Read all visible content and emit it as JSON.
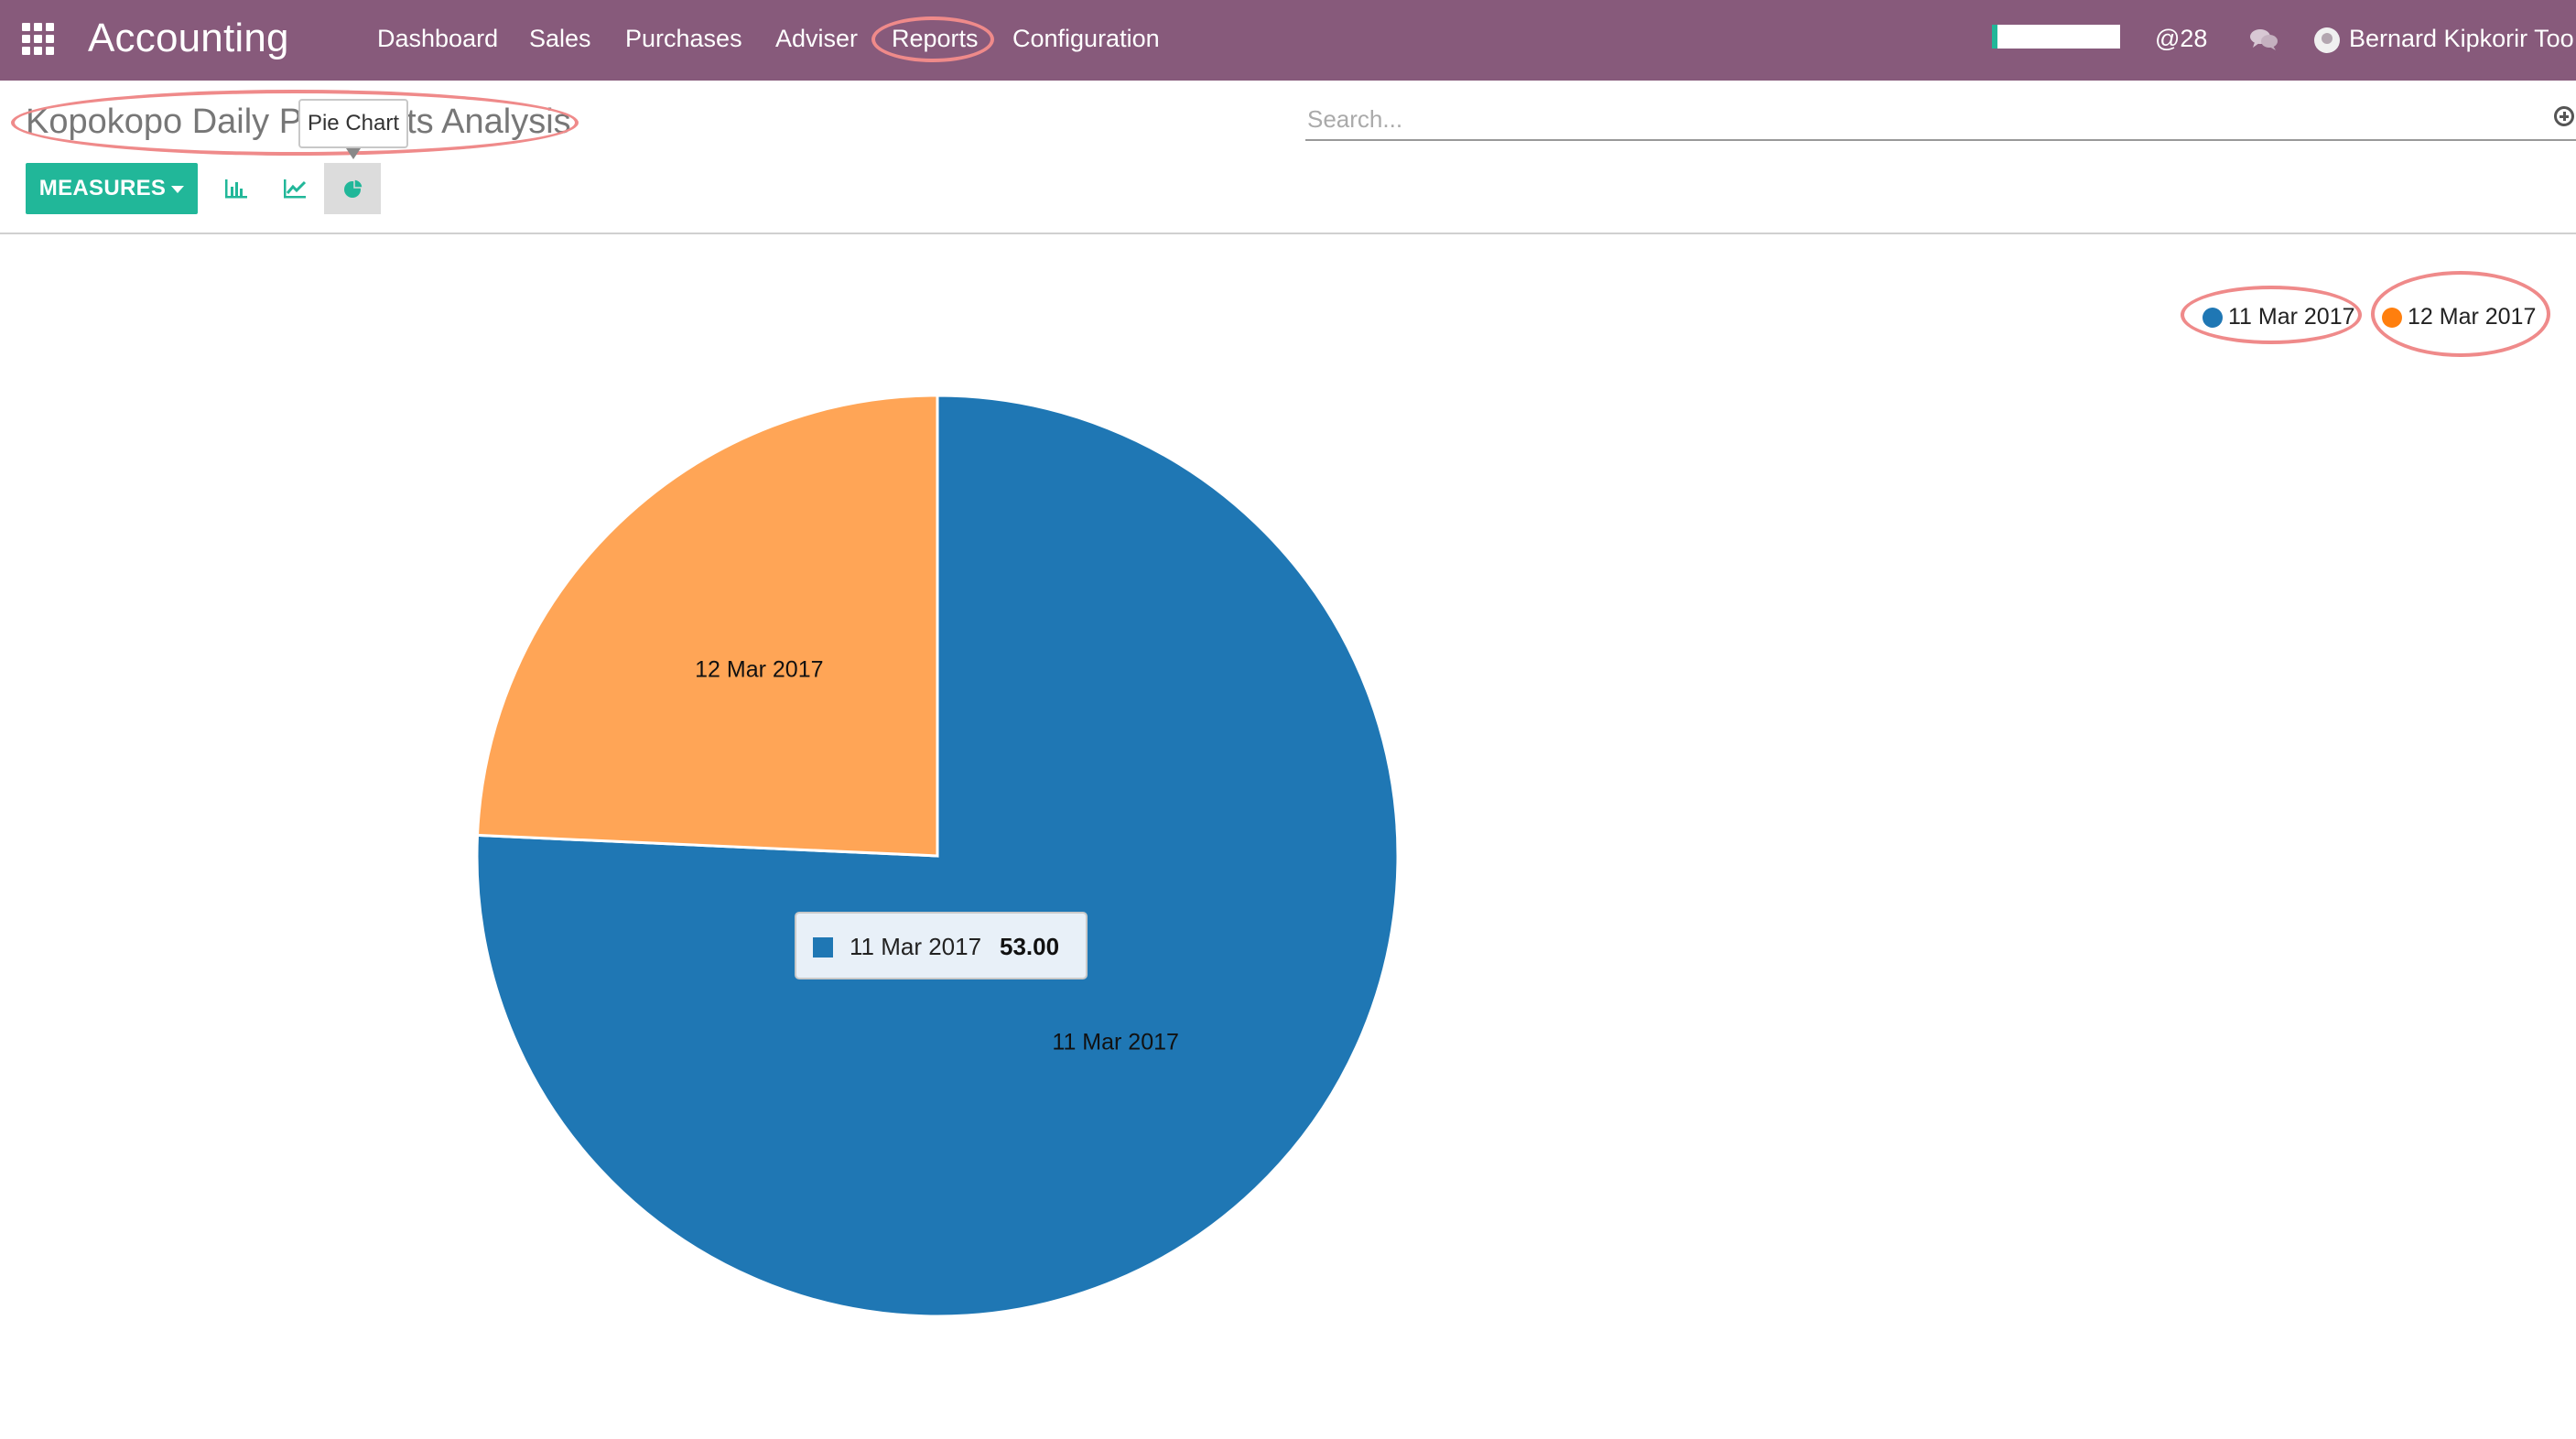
{
  "navbar": {
    "brand": "Accounting",
    "menu": [
      {
        "label": "Dashboard"
      },
      {
        "label": "Sales"
      },
      {
        "label": "Purchases"
      },
      {
        "label": "Adviser"
      },
      {
        "label": "Reports"
      },
      {
        "label": "Configuration"
      }
    ],
    "mentions_label": "@28",
    "user_name": "Bernard Kipkorir Too",
    "progress_fraction": 0.04
  },
  "control_panel": {
    "title": "Kopokopo Daily Payments Analysis",
    "tooltip": "Pie Chart",
    "search_placeholder": "Search...",
    "measures_label": "MEASURES",
    "view_modes": [
      "bar-chart-icon",
      "line-chart-icon",
      "pie-chart-icon"
    ],
    "active_mode": "pie-chart-icon"
  },
  "chart_data": {
    "type": "pie",
    "categories": [
      "11 Mar 2017",
      "12 Mar 2017"
    ],
    "values": [
      53.0,
      17.0
    ],
    "colors": [
      "#1f77b4",
      "#ffa556"
    ],
    "legend_colors": [
      "#1f77b4",
      "#ff7f0e"
    ],
    "legend_position": "top-right",
    "tooltip": {
      "label": "11 Mar 2017",
      "value": "53.00"
    }
  }
}
